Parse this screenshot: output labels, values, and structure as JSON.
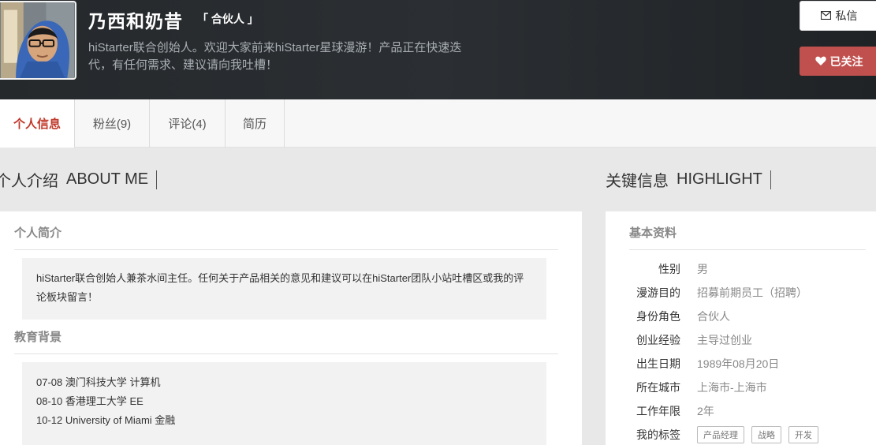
{
  "profile": {
    "name": "乃西和奶昔",
    "role_tag": "「 合伙人 」",
    "bio": "hiStarter联合创始人。欢迎大家前来hiStarter星球漫游！产品正在快速迭代，有任何需求、建议请向我吐槽！"
  },
  "actions": {
    "message_label": "私信",
    "follow_label": "已关注",
    "message_icon": "envelope-icon",
    "follow_icon": "heart-icon"
  },
  "tabs": [
    {
      "label": "个人信息"
    },
    {
      "label": "粉丝(9)"
    },
    {
      "label": "评论(4)"
    },
    {
      "label": "简历"
    }
  ],
  "about": {
    "title": "个人介绍",
    "title_en": "ABOUT ME",
    "intro_heading": "个人简介",
    "intro_text": "hiStarter联合创始人兼茶水间主任。任何关于产品相关的意见和建议可以在hiStarter团队小站吐槽区或我的评论板块留言！",
    "education_heading": "教育背景",
    "education": [
      {
        "text": "07-08 澳门科技大学 计算机"
      },
      {
        "text": "08-10 香港理工大学 EE"
      },
      {
        "text": "10-12 University of Miami 金融"
      }
    ]
  },
  "highlight": {
    "title": "关键信息",
    "title_en": "HIGHLIGHT",
    "basic_heading": "基本资料",
    "rows": [
      {
        "label": "性别",
        "value": "男"
      },
      {
        "label": "漫游目的",
        "value": "招募前期员工（招聘）"
      },
      {
        "label": "身份角色",
        "value": "合伙人"
      },
      {
        "label": "创业经验",
        "value": "主导过创业"
      },
      {
        "label": "出生日期",
        "value": "1989年08月20日"
      },
      {
        "label": "所在城市",
        "value": "上海市-上海市"
      },
      {
        "label": "工作年限",
        "value": "2年"
      }
    ],
    "tags_label": "我的标签",
    "tags": [
      "产品经理",
      "战略",
      "开发"
    ]
  },
  "colors": {
    "accent": "#c0504d",
    "header_bg": "#272b2e",
    "tab_active": "#c0392b"
  }
}
